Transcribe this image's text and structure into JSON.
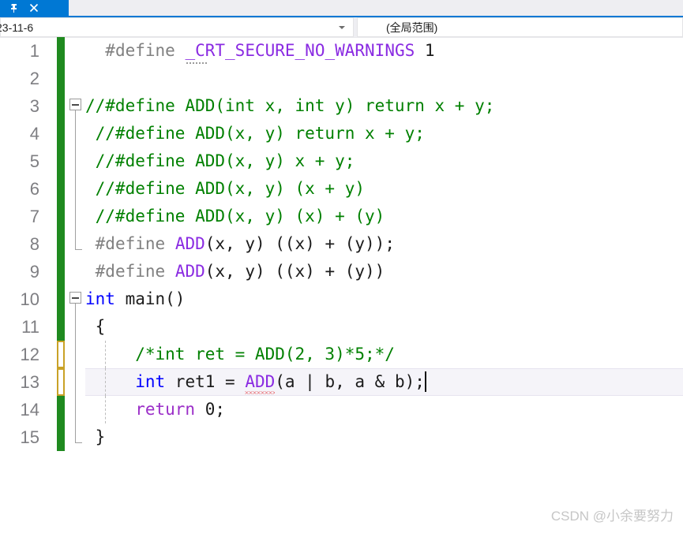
{
  "window": {
    "tab": {
      "pin_icon": "pin-icon",
      "close_icon": "close-icon",
      "accent_color": "#0078d4"
    }
  },
  "navbar": {
    "scope_dropdown": {
      "value": "23-11-6",
      "icon": "chevron-down-icon"
    },
    "member_dropdown": {
      "value": "(全局范围)"
    }
  },
  "editor": {
    "language": "C",
    "current_line": 13,
    "colors": {
      "preprocessor": "#808080",
      "macro": "#8a2be2",
      "comment": "#008000",
      "keyword": "#0000ff",
      "control_keyword": "#9b2ec8",
      "plain": "#1b1b1b",
      "change_saved": "#1f8a1f",
      "change_unsaved": "#c9a227",
      "current_line_bg": "#f5f4f9",
      "error_squiggle": "#e01b24",
      "line_number": "#7e7e82"
    },
    "lines": [
      {
        "number": "1",
        "change": "saved",
        "outline": "none",
        "tokens": [
          {
            "text": "  ",
            "cls": "t-plain"
          },
          {
            "text": "#define ",
            "cls": "t-pp"
          },
          {
            "text": "_CR",
            "cls": "t-macro",
            "hint": true
          },
          {
            "text": "T_SECURE_NO_WARNINGS",
            "cls": "t-macro"
          },
          {
            "text": " ",
            "cls": "t-plain"
          },
          {
            "text": "1",
            "cls": "t-num"
          }
        ]
      },
      {
        "number": "2",
        "change": "saved",
        "outline": "none",
        "tokens": []
      },
      {
        "number": "3",
        "change": "saved",
        "outline": "fold-open",
        "tokens": [
          {
            "text": "//#define ADD(int x, int y) return x + y;",
            "cls": "t-comment"
          }
        ]
      },
      {
        "number": "4",
        "change": "saved",
        "outline": "line",
        "tokens": [
          {
            "text": " //#define ADD(x, y) return x + y;",
            "cls": "t-comment"
          }
        ]
      },
      {
        "number": "5",
        "change": "saved",
        "outline": "line",
        "tokens": [
          {
            "text": " //#define ADD(x, y) x + y;",
            "cls": "t-comment"
          }
        ]
      },
      {
        "number": "6",
        "change": "saved",
        "outline": "line",
        "tokens": [
          {
            "text": " //#define ADD(x, y) (x + y)",
            "cls": "t-comment"
          }
        ]
      },
      {
        "number": "7",
        "change": "saved",
        "outline": "line",
        "tokens": [
          {
            "text": " //#define ADD(x, y) (x) + (y)",
            "cls": "t-comment"
          }
        ]
      },
      {
        "number": "8",
        "change": "saved",
        "outline": "end",
        "tokens": [
          {
            "text": " ",
            "cls": "t-plain"
          },
          {
            "text": "#define ",
            "cls": "t-pp"
          },
          {
            "text": "ADD",
            "cls": "t-macro"
          },
          {
            "text": "(x, y) ((x) + (y));",
            "cls": "t-plain"
          }
        ]
      },
      {
        "number": "9",
        "change": "saved",
        "outline": "none",
        "tokens": [
          {
            "text": " ",
            "cls": "t-plain"
          },
          {
            "text": "#define ",
            "cls": "t-pp"
          },
          {
            "text": "ADD",
            "cls": "t-macro"
          },
          {
            "text": "(x, y) ((x) + (y))",
            "cls": "t-plain"
          }
        ]
      },
      {
        "number": "10",
        "change": "saved",
        "outline": "fold-open",
        "tokens": [
          {
            "text": "int",
            "cls": "t-kw"
          },
          {
            "text": " main()",
            "cls": "t-plain"
          }
        ]
      },
      {
        "number": "11",
        "change": "saved",
        "outline": "line",
        "tokens": [
          {
            "text": " {",
            "cls": "t-plain"
          }
        ]
      },
      {
        "number": "12",
        "change": "unsaved",
        "outline": "line",
        "guides": [
          1
        ],
        "tokens": [
          {
            "text": "     /*int ret = ADD(2, 3)*5;*/",
            "cls": "t-comment"
          }
        ]
      },
      {
        "number": "13",
        "change": "unsaved",
        "outline": "line",
        "current": true,
        "guides": [
          1
        ],
        "tokens": [
          {
            "text": "     ",
            "cls": "t-plain"
          },
          {
            "text": "int",
            "cls": "t-kw"
          },
          {
            "text": " ret1 = ",
            "cls": "t-plain"
          },
          {
            "text": "ADD",
            "cls": "t-macro",
            "squiggle": true
          },
          {
            "text": "(a | b, a & b);",
            "cls": "t-plain"
          },
          {
            "text": "",
            "cls": "caret"
          }
        ]
      },
      {
        "number": "14",
        "change": "saved",
        "outline": "line",
        "guides": [
          1
        ],
        "tokens": [
          {
            "text": "     ",
            "cls": "t-plain"
          },
          {
            "text": "return",
            "cls": "t-ctrl"
          },
          {
            "text": " 0;",
            "cls": "t-plain"
          }
        ]
      },
      {
        "number": "15",
        "change": "saved",
        "outline": "end",
        "tokens": [
          {
            "text": " }",
            "cls": "t-plain"
          }
        ]
      }
    ]
  },
  "watermark": {
    "text": "CSDN @小余要努力"
  }
}
